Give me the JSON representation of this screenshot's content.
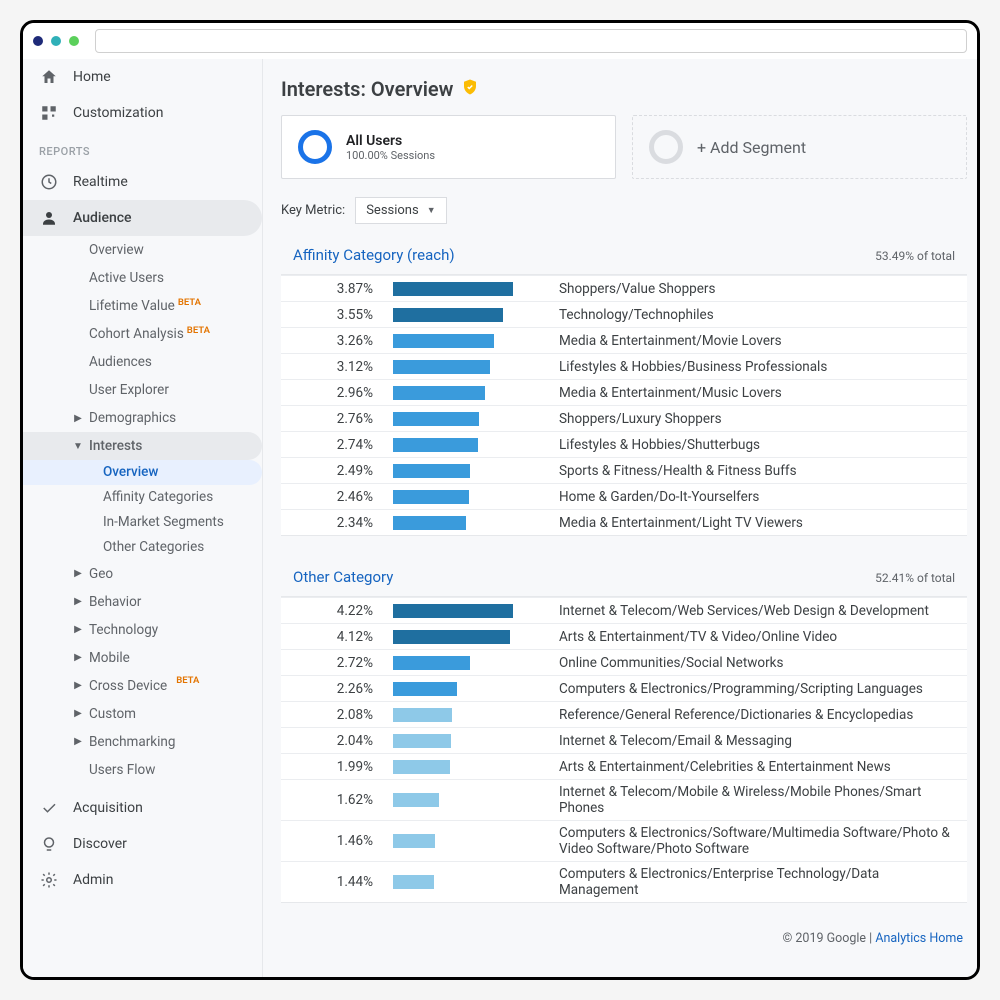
{
  "sidebar": {
    "home": "Home",
    "customization": "Customization",
    "reports_heading": "REPORTS",
    "realtime": "Realtime",
    "audience": "Audience",
    "audience_sub": {
      "overview": "Overview",
      "active_users": "Active Users",
      "lifetime_value": "Lifetime Value",
      "cohort_analysis": "Cohort Analysis",
      "audiences": "Audiences",
      "user_explorer": "User Explorer",
      "demographics": "Demographics",
      "interests": "Interests",
      "interests_sub": {
        "overview": "Overview",
        "affinity": "Affinity Categories",
        "in_market": "In-Market Segments",
        "other": "Other Categories"
      },
      "geo": "Geo",
      "behavior": "Behavior",
      "technology": "Technology",
      "mobile": "Mobile",
      "cross_device": "Cross Device",
      "custom": "Custom",
      "benchmarking": "Benchmarking",
      "users_flow": "Users Flow"
    },
    "acquisition": "Acquisition",
    "discover": "Discover",
    "admin": "Admin"
  },
  "page": {
    "title": "Interests: Overview",
    "all_users": "All Users",
    "all_users_sub": "100.00% Sessions",
    "add_segment": "+ Add Segment",
    "key_metric_label": "Key Metric:",
    "key_metric_value": "Sessions"
  },
  "affinity": {
    "title": "Affinity Category (reach)",
    "total_pct": "53.49% of total"
  },
  "other": {
    "title": "Other Category",
    "total_pct": "52.41% of total"
  },
  "chart_data": [
    {
      "type": "bar",
      "title": "Affinity Category (reach)",
      "xlabel": "",
      "ylabel": "",
      "series": [
        {
          "pct": "3.87%",
          "value": 3.87,
          "label": "Shoppers/Value Shoppers",
          "tone": "dark"
        },
        {
          "pct": "3.55%",
          "value": 3.55,
          "label": "Technology/Technophiles",
          "tone": "dark"
        },
        {
          "pct": "3.26%",
          "value": 3.26,
          "label": "Media & Entertainment/Movie Lovers",
          "tone": "mid"
        },
        {
          "pct": "3.12%",
          "value": 3.12,
          "label": "Lifestyles & Hobbies/Business Professionals",
          "tone": "mid"
        },
        {
          "pct": "2.96%",
          "value": 2.96,
          "label": "Media & Entertainment/Music Lovers",
          "tone": "mid"
        },
        {
          "pct": "2.76%",
          "value": 2.76,
          "label": "Shoppers/Luxury Shoppers",
          "tone": "mid"
        },
        {
          "pct": "2.74%",
          "value": 2.74,
          "label": "Lifestyles & Hobbies/Shutterbugs",
          "tone": "mid"
        },
        {
          "pct": "2.49%",
          "value": 2.49,
          "label": "Sports & Fitness/Health & Fitness Buffs",
          "tone": "mid"
        },
        {
          "pct": "2.46%",
          "value": 2.46,
          "label": "Home & Garden/Do-It-Yourselfers",
          "tone": "mid"
        },
        {
          "pct": "2.34%",
          "value": 2.34,
          "label": "Media & Entertainment/Light TV Viewers",
          "tone": "mid"
        }
      ],
      "max": 3.87
    },
    {
      "type": "bar",
      "title": "Other Category",
      "xlabel": "",
      "ylabel": "",
      "series": [
        {
          "pct": "4.22%",
          "value": 4.22,
          "label": "Internet & Telecom/Web Services/Web Design & Development",
          "tone": "dark"
        },
        {
          "pct": "4.12%",
          "value": 4.12,
          "label": "Arts & Entertainment/TV & Video/Online Video",
          "tone": "dark"
        },
        {
          "pct": "2.72%",
          "value": 2.72,
          "label": "Online Communities/Social Networks",
          "tone": "mid"
        },
        {
          "pct": "2.26%",
          "value": 2.26,
          "label": "Computers & Electronics/Programming/Scripting Languages",
          "tone": "mid"
        },
        {
          "pct": "2.08%",
          "value": 2.08,
          "label": "Reference/General Reference/Dictionaries & Encyclopedias",
          "tone": "light"
        },
        {
          "pct": "2.04%",
          "value": 2.04,
          "label": "Internet & Telecom/Email & Messaging",
          "tone": "light"
        },
        {
          "pct": "1.99%",
          "value": 1.99,
          "label": "Arts & Entertainment/Celebrities & Entertainment News",
          "tone": "light"
        },
        {
          "pct": "1.62%",
          "value": 1.62,
          "label": "Internet & Telecom/Mobile & Wireless/Mobile Phones/Smart Phones",
          "tone": "light"
        },
        {
          "pct": "1.46%",
          "value": 1.46,
          "label": "Computers & Electronics/Software/Multimedia Software/Photo & Video Software/Photo Software",
          "tone": "light"
        },
        {
          "pct": "1.44%",
          "value": 1.44,
          "label": "Computers & Electronics/Enterprise Technology/Data Management",
          "tone": "light"
        }
      ],
      "max": 4.22
    }
  ],
  "footer": {
    "copyright": "© 2019 Google",
    "link": "Analytics Home"
  }
}
